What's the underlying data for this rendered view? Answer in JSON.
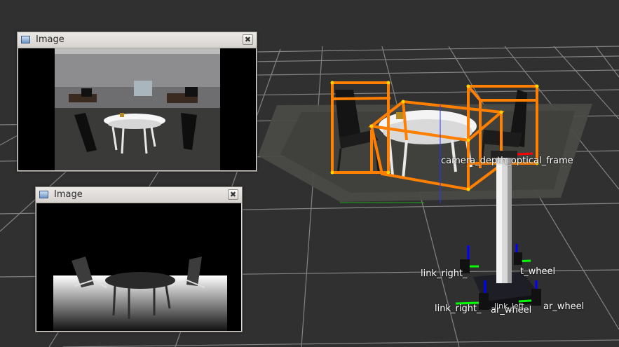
{
  "windows": {
    "rgb": {
      "title": "Image",
      "close_glyph": "✖"
    },
    "depth": {
      "title": "Image",
      "close_glyph": "✖"
    }
  },
  "viewport": {
    "frame_labels": {
      "camera": "camera_depth_optical_frame",
      "right_wheel_visible": "link_right_",
      "right_wheel_suffix": "t_wheel",
      "right_rear_wheel": "link_right_",
      "right_rear_overlap": "ar_wheel",
      "left_rear_fragment": "ar_wheel",
      "center_overlap": "link_left"
    },
    "colors": {
      "background": "#303030",
      "grid": "#8c8c8c",
      "bounding_box": "#ff7f00",
      "corner_point": "#ffd400",
      "axis_x": "#ff0000",
      "axis_y": "#00ff00",
      "axis_z": "#0000ff"
    }
  }
}
